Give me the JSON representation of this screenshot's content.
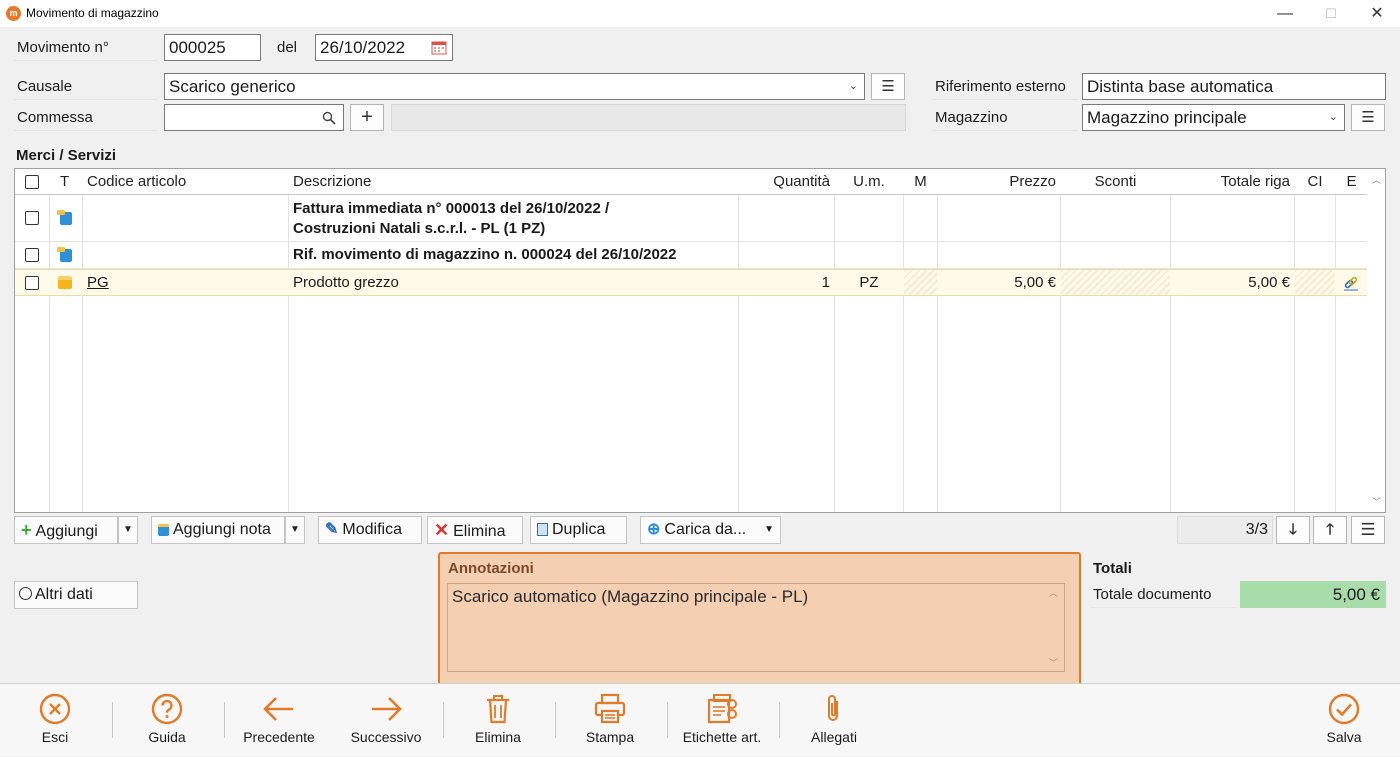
{
  "window": {
    "title": "Movimento di magazzino",
    "minimize": "—",
    "maximize": "☐",
    "close": "✕"
  },
  "form": {
    "movimento_label": "Movimento n°",
    "movimento_value": "000025",
    "del_label": "del",
    "date_value": "26/10/2022",
    "causale_label": "Causale",
    "causale_value": "Scarico generico",
    "commessa_label": "Commessa",
    "commessa_value": "",
    "riferimento_label": "Riferimento esterno",
    "riferimento_value": "Distinta base automatica",
    "magazzino_label": "Magazzino",
    "magazzino_value": "Magazzino principale"
  },
  "section_title": "Merci / Servizi",
  "grid": {
    "headers": {
      "type": "T",
      "codice": "Codice articolo",
      "descrizione": "Descrizione",
      "quantita": "Quantità",
      "um": "U.m.",
      "m": "M",
      "prezzo": "Prezzo",
      "sconti": "Sconti",
      "totale": "Totale riga",
      "ci": "CI",
      "e": "E"
    },
    "rows": [
      {
        "type_icon": "note-icon",
        "desc_line1": "Fattura immediata n° 000013 del 26/10/2022 /",
        "desc_line2": "Costruzioni Natali s.c.r.l. - PL (1 PZ)"
      },
      {
        "type_icon": "note-icon",
        "desc_line1": "Rif. movimento di magazzino n. 000024 del 26/10/2022"
      },
      {
        "type_icon": "box-icon",
        "codice": "PG",
        "descrizione": "Prodotto grezzo",
        "quantita": "1",
        "um": "PZ",
        "prezzo": "5,00 €",
        "totale": "5,00 €",
        "e_icon": "link-icon"
      }
    ]
  },
  "grid_toolbar": {
    "aggiungi": "Aggiungi",
    "aggiungi_nota": "Aggiungi nota",
    "modifica": "Modifica",
    "elimina": "Elimina",
    "duplica": "Duplica",
    "carica": "Carica da...",
    "pager": "3/3"
  },
  "altri_dati": "Altri dati",
  "annotazioni": {
    "title": "Annotazioni",
    "text": "Scarico automatico (Magazzino principale - PL)"
  },
  "totali": {
    "title": "Totali",
    "label": "Totale documento",
    "value": "5,00 €"
  },
  "bottom_bar": {
    "esci": "Esci",
    "guida": "Guida",
    "precedente": "Precedente",
    "successivo": "Successivo",
    "elimina": "Elimina",
    "stampa": "Stampa",
    "etichette": "Etichette art.",
    "allegati": "Allegati",
    "salva": "Salva"
  },
  "colors": {
    "accent": "#e07b2c",
    "total_bg": "#a9dcab",
    "annot_bg": "#f5cfb2",
    "row_selected": "#fffbe8"
  }
}
